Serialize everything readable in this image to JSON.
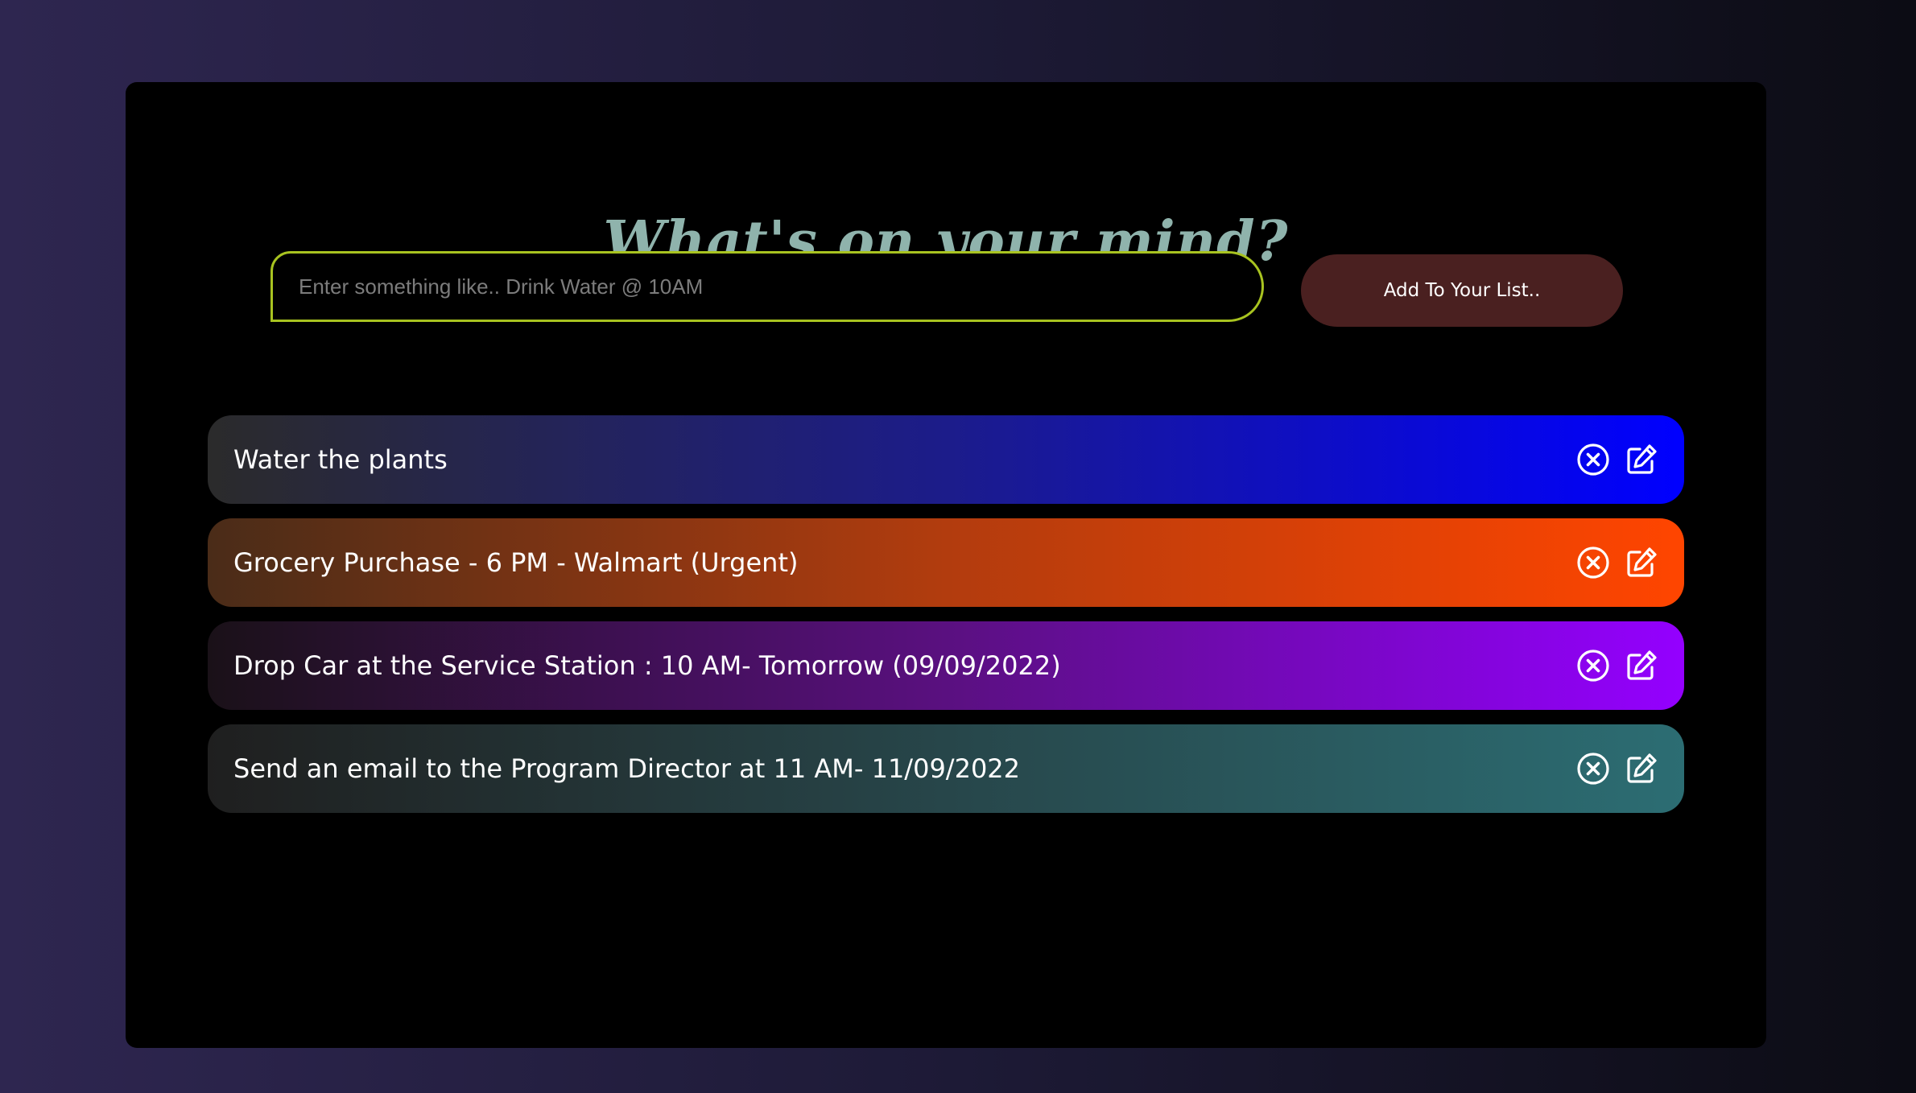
{
  "header": {
    "title": "What's on your mind?"
  },
  "form": {
    "input_value": "",
    "input_placeholder": "Enter something like.. Drink Water @ 10AM",
    "add_button_label": "Add To Your List.."
  },
  "todos": [
    {
      "text": "Water the plants",
      "gradient": [
        "#2b2b2b",
        "#1c1c8a",
        "#0000ff"
      ],
      "delete_icon": "circle-x-icon",
      "edit_icon": "edit-icon"
    },
    {
      "text": "Grocery Purchase - 6 PM - Walmart (Urgent)",
      "gradient": [
        "#4a2c18",
        "#b23c0e",
        "#ff4500"
      ],
      "delete_icon": "circle-x-icon",
      "edit_icon": "edit-icon"
    },
    {
      "text": "Drop Car at the Service Station : 10 AM- Tomorrow (09/09/2022)",
      "gradient": [
        "#1a1118",
        "#5a1080",
        "#9400ff"
      ],
      "delete_icon": "circle-x-icon",
      "edit_icon": "edit-icon"
    },
    {
      "text": "Send an email to the Program Director at 11 AM- 11/09/2022",
      "gradient": [
        "#1f1f1f",
        "#27464a",
        "#2c6d73"
      ],
      "delete_icon": "circle-x-icon",
      "edit_icon": "edit-icon"
    }
  ],
  "colors": {
    "title": "#8fb3ac",
    "input_border": "#a8c320",
    "button_bg": "#4a2020"
  }
}
